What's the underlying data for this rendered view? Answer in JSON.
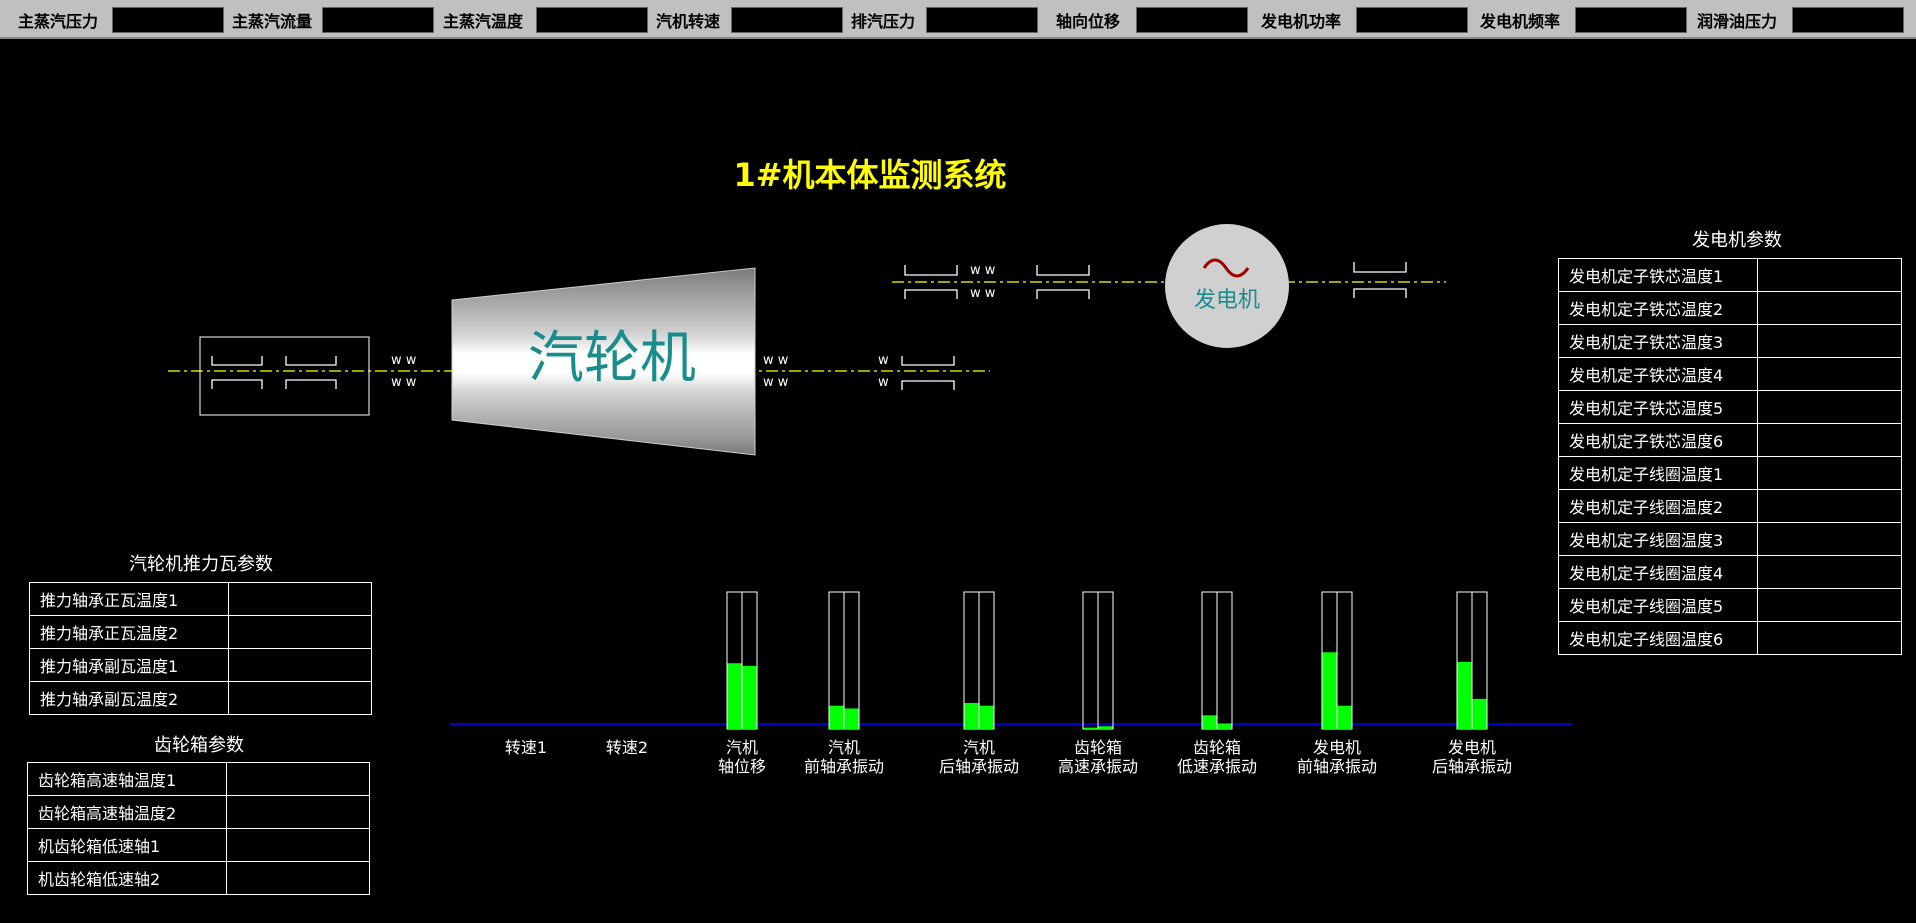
{
  "topbar": {
    "items": [
      {
        "label": "主蒸汽压力",
        "value": ""
      },
      {
        "label": "主蒸汽流量",
        "value": ""
      },
      {
        "label": "主蒸汽温度",
        "value": ""
      },
      {
        "label": "汽机转速",
        "value": ""
      },
      {
        "label": "排汽压力",
        "value": ""
      },
      {
        "label": "轴向位移",
        "value": ""
      },
      {
        "label": "发电机功率",
        "value": ""
      },
      {
        "label": "发电机频率",
        "value": ""
      },
      {
        "label": "润滑油压力",
        "value": ""
      }
    ]
  },
  "title": "1#机本体监测系统",
  "diagram": {
    "turbine_label": "汽轮机",
    "generator_label": "发电机",
    "generator_symbol": "~"
  },
  "thrust": {
    "title": "汽轮机推力瓦参数",
    "rows": [
      {
        "label": "推力轴承正瓦温度1",
        "value": ""
      },
      {
        "label": "推力轴承正瓦温度2",
        "value": ""
      },
      {
        "label": "推力轴承副瓦温度1",
        "value": ""
      },
      {
        "label": "推力轴承副瓦温度2",
        "value": ""
      }
    ]
  },
  "gearbox": {
    "title": "齿轮箱参数",
    "rows": [
      {
        "label": "齿轮箱高速轴温度1",
        "value": ""
      },
      {
        "label": "齿轮箱高速轴温度2",
        "value": ""
      },
      {
        "label": "机齿轮箱低速轴1",
        "value": ""
      },
      {
        "label": "机齿轮箱低速轴2",
        "value": ""
      }
    ]
  },
  "generator_params": {
    "title": "发电机参数",
    "rows": [
      {
        "label": "发电机定子铁芯温度1",
        "value": ""
      },
      {
        "label": "发电机定子铁芯温度2",
        "value": ""
      },
      {
        "label": "发电机定子铁芯温度3",
        "value": ""
      },
      {
        "label": "发电机定子铁芯温度4",
        "value": ""
      },
      {
        "label": "发电机定子铁芯温度5",
        "value": ""
      },
      {
        "label": "发电机定子铁芯温度6",
        "value": ""
      },
      {
        "label": "发电机定子线圈温度1",
        "value": ""
      },
      {
        "label": "发电机定子线圈温度2",
        "value": ""
      },
      {
        "label": "发电机定子线圈温度3",
        "value": ""
      },
      {
        "label": "发电机定子线圈温度4",
        "value": ""
      },
      {
        "label": "发电机定子线圈温度5",
        "value": ""
      },
      {
        "label": "发电机定子线圈温度6",
        "value": ""
      }
    ]
  },
  "bars": {
    "fill_color": "#00ff00",
    "baseline_color": "#0000cc",
    "items": [
      {
        "label": "转速1",
        "levels": []
      },
      {
        "label": "转速2",
        "levels": []
      },
      {
        "label": "汽机\n轴位移",
        "levels": [
          0.48,
          0.46
        ]
      },
      {
        "label": "汽机\n前轴承振动",
        "levels": [
          0.17,
          0.15
        ]
      },
      {
        "label": "汽机\n后轴承振动",
        "levels": [
          0.19,
          0.17
        ]
      },
      {
        "label": "齿轮箱\n高速承振动",
        "levels": [
          0.01,
          0.02
        ]
      },
      {
        "label": "齿轮箱\n低速承振动",
        "levels": [
          0.1,
          0.04
        ]
      },
      {
        "label": "发电机\n前轴承振动",
        "levels": [
          0.56,
          0.17
        ]
      },
      {
        "label": "发电机\n后轴承振动",
        "levels": [
          0.49,
          0.22
        ]
      }
    ]
  }
}
